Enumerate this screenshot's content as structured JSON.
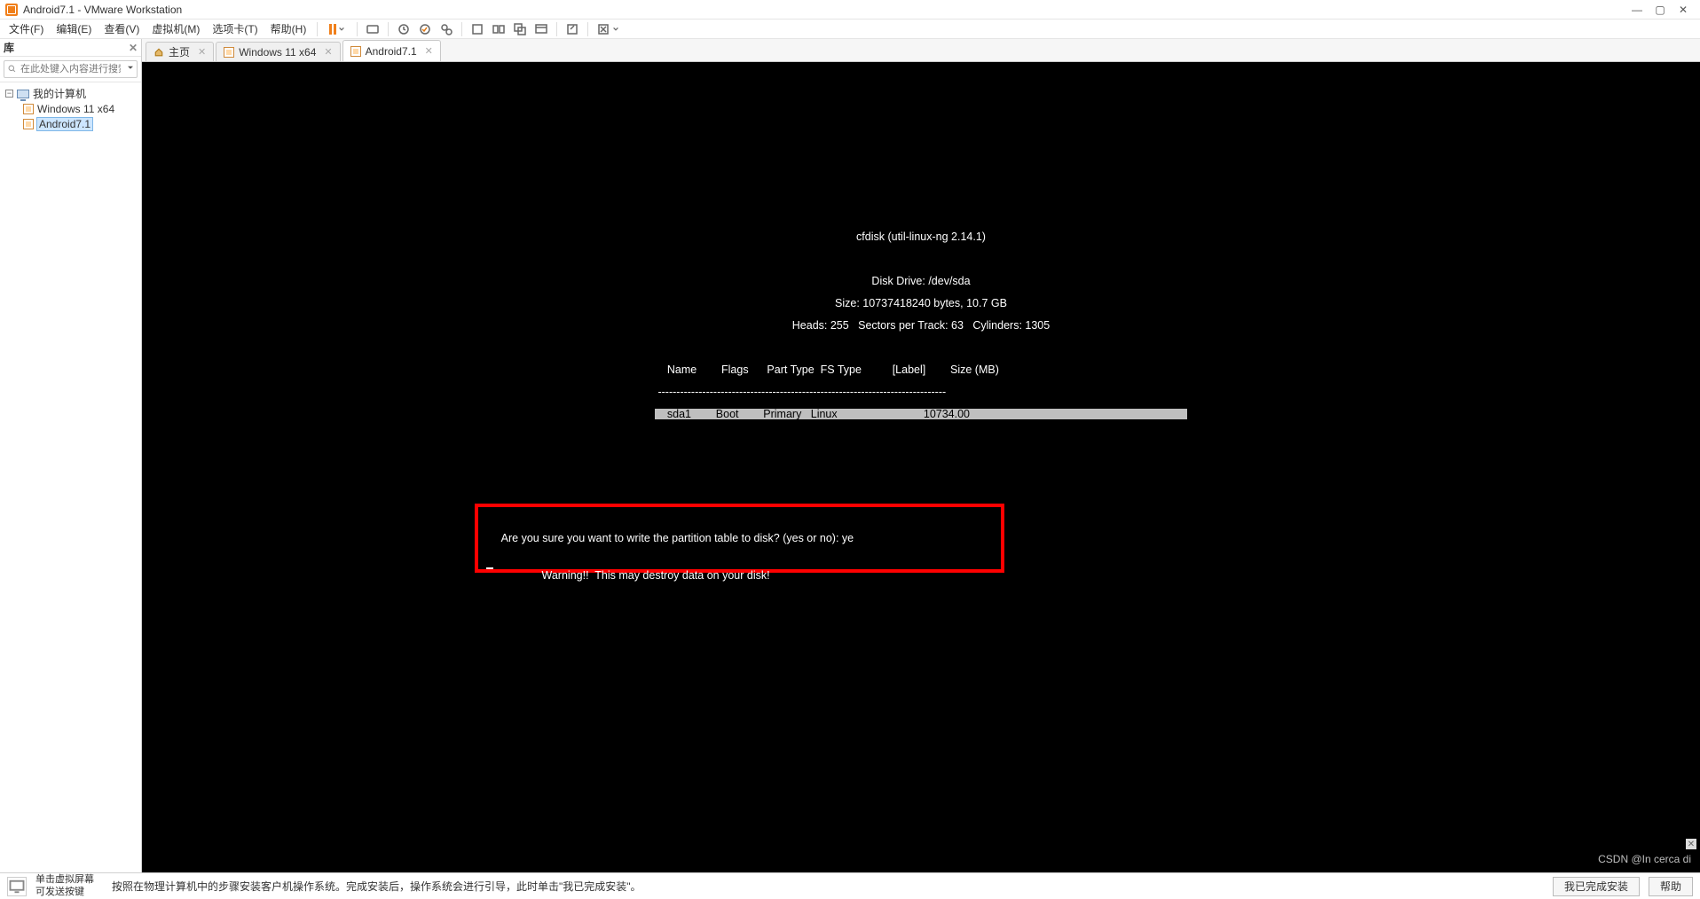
{
  "window": {
    "title": "Android7.1 - VMware Workstation",
    "controls": {
      "min": "—",
      "max": "▢",
      "close": "✕"
    }
  },
  "menubar": {
    "items": [
      "文件(F)",
      "编辑(E)",
      "查看(V)",
      "虚拟机(M)",
      "选项卡(T)",
      "帮助(H)"
    ]
  },
  "sidebar": {
    "header": "库",
    "close": "✕",
    "search_placeholder": "在此处键入内容进行搜索",
    "root": "我的计算机",
    "items": [
      {
        "label": "Windows 11 x64",
        "selected": false
      },
      {
        "label": "Android7.1",
        "selected": true
      }
    ]
  },
  "tabs": [
    {
      "label": "主页",
      "kind": "home",
      "active": false,
      "closeable": true
    },
    {
      "label": "Windows 11 x64",
      "kind": "vm",
      "active": false,
      "closeable": true
    },
    {
      "label": "Android7.1",
      "kind": "vm",
      "active": true,
      "closeable": true
    }
  ],
  "console": {
    "title": "cfdisk (util-linux-ng 2.14.1)",
    "drive": "Disk Drive: /dev/sda",
    "size": "Size: 10737418240 bytes, 10.7 GB",
    "geom": "Heads: 255   Sectors per Track: 63   Cylinders: 1305",
    "columns": "    Name        Flags      Part Type  FS Type          [Label]        Size (MB)",
    "dashes": " ------------------------------------------------------------------------------",
    "row": "    sda1        Boot        Primary   Linux                            10734.00",
    "prompt": "     Are you sure you want to write the partition table to disk? (yes or no): ye",
    "warn": "                  Warning!!  This may destroy data on your disk!"
  },
  "bottombar": {
    "hint_title": "单击虚拟屏幕",
    "hint_sub": "可发送按键",
    "msg": "按照在物理计算机中的步骤安装客户机操作系统。完成安装后，操作系统会进行引导，此时单击\"我已完成安装\"。",
    "done": "我已完成安装",
    "help": "帮助"
  },
  "watermark": "CSDN @In cerca di"
}
